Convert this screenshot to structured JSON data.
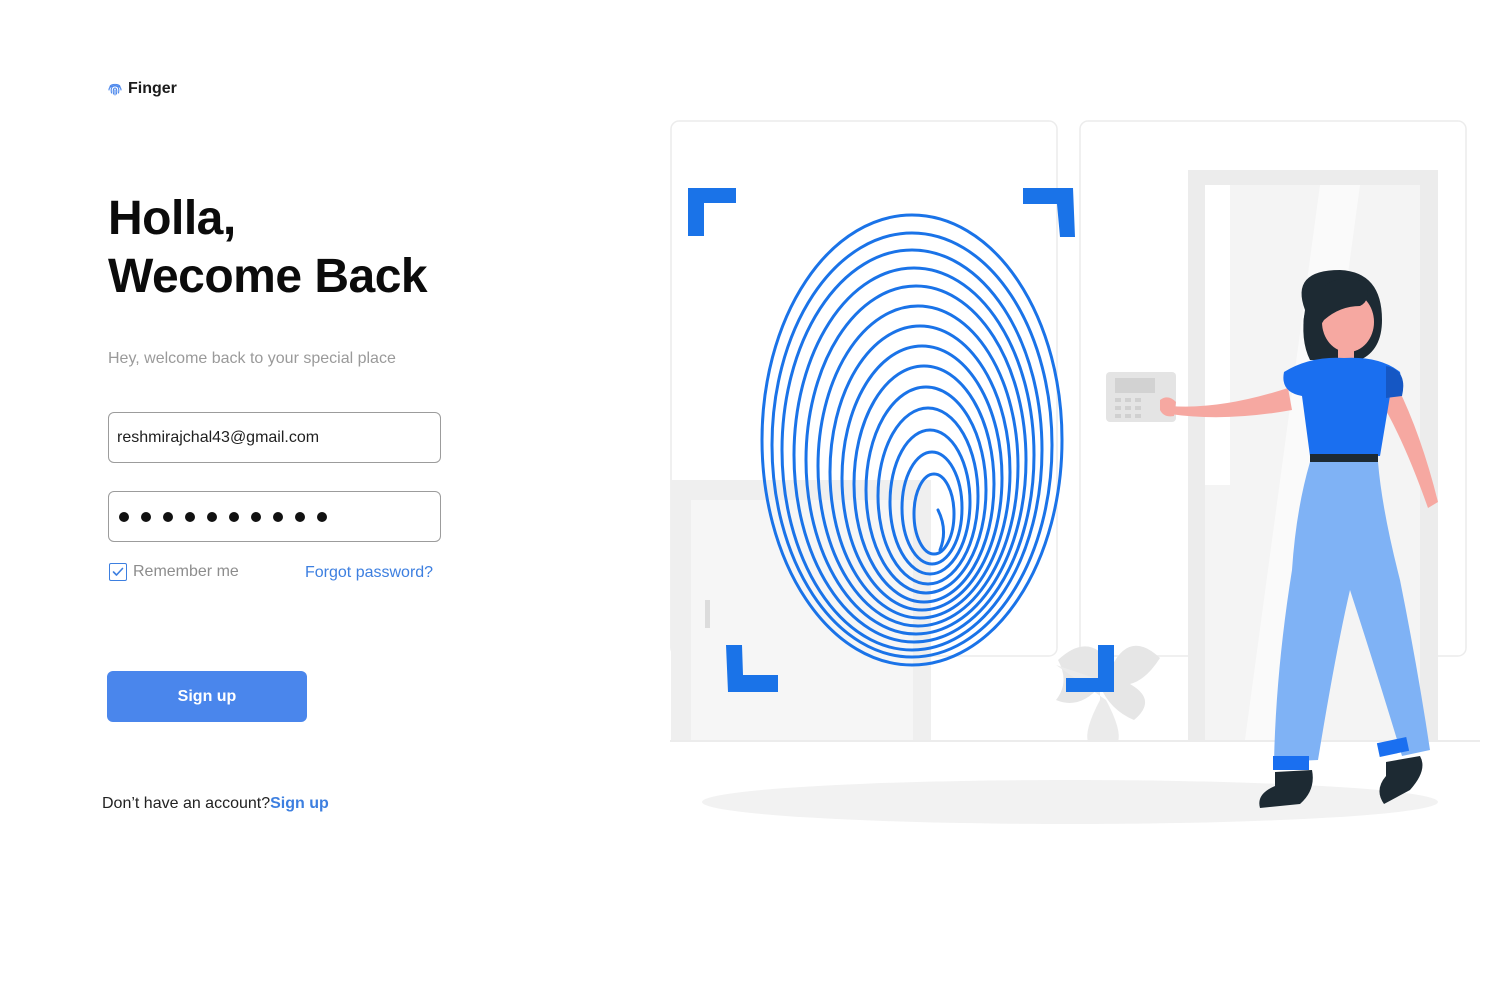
{
  "brand": {
    "name": "Finger",
    "icon": "fingerprint-icon"
  },
  "headline": {
    "line1": "Holla,",
    "line2": "Wecome Back"
  },
  "subtitle": "Hey, welcome back to your special place",
  "form": {
    "email_value": "reshmirajchal43@gmail.com",
    "password_masked_count": 10,
    "remember_label": "Remember me",
    "remember_checked": true,
    "forgot_label": "Forgot password?",
    "submit_label": "Sign up"
  },
  "footer": {
    "prompt": "Don’t have an account?",
    "link_label": "Sign up"
  },
  "colors": {
    "accent": "#4a86ec",
    "link": "#3d7fe0",
    "fingerprint": "#1a73e8",
    "shirt": "#1a6ff0",
    "pants": "#7fb2f5"
  },
  "illustration": {
    "subject": "woman-scanning-fingerprint",
    "icon": "fingerprint-scan-illustration"
  }
}
